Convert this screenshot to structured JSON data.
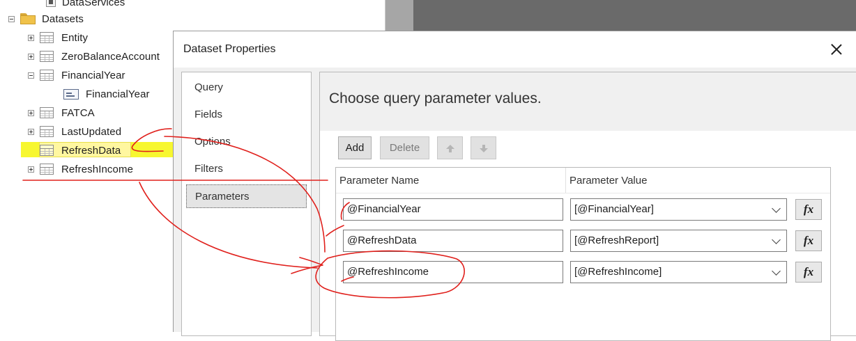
{
  "tree": {
    "items": [
      {
        "label": "DataServices",
        "kind": "datasource"
      },
      {
        "label": "Datasets",
        "kind": "folder",
        "expander": "minus"
      },
      {
        "label": "Entity",
        "kind": "table",
        "expander": "plus"
      },
      {
        "label": "ZeroBalanceAccount",
        "kind": "table",
        "expander": "plus"
      },
      {
        "label": "FinancialYear",
        "kind": "table",
        "expander": "minus"
      },
      {
        "label": "FinancialYear",
        "kind": "field"
      },
      {
        "label": "FATCA",
        "kind": "table",
        "expander": "plus"
      },
      {
        "label": "LastUpdated",
        "kind": "table",
        "expander": "plus"
      },
      {
        "label": "RefreshData",
        "kind": "table",
        "selected": true,
        "highlight_color": "#f7f730"
      },
      {
        "label": "RefreshIncome",
        "kind": "table",
        "expander": "plus"
      }
    ]
  },
  "dialog": {
    "title": "Dataset Properties",
    "close_icon": "close-icon",
    "nav": [
      "Query",
      "Fields",
      "Options",
      "Filters",
      "Parameters"
    ],
    "active_nav": "Parameters",
    "heading": "Choose query parameter values.",
    "toolbar": {
      "add_label": "Add",
      "delete_label": "Delete",
      "move_up_icon": "arrow-up-icon",
      "move_down_icon": "arrow-down-icon"
    },
    "grid": {
      "name_header": "Parameter Name",
      "value_header": "Parameter Value",
      "rows": [
        {
          "name": "@FinancialYear",
          "value": "[@FinancialYear]",
          "fx": "fx"
        },
        {
          "name": "@RefreshData",
          "value": "[@RefreshReport]",
          "fx": "fx"
        },
        {
          "name": "@RefreshIncome",
          "value": "[@RefreshIncome]",
          "fx": "fx"
        }
      ]
    }
  },
  "colors": {
    "annotation_ink": "#e0201c",
    "highlighter": "#f7f730",
    "background_dark": "#6a6a6a"
  }
}
